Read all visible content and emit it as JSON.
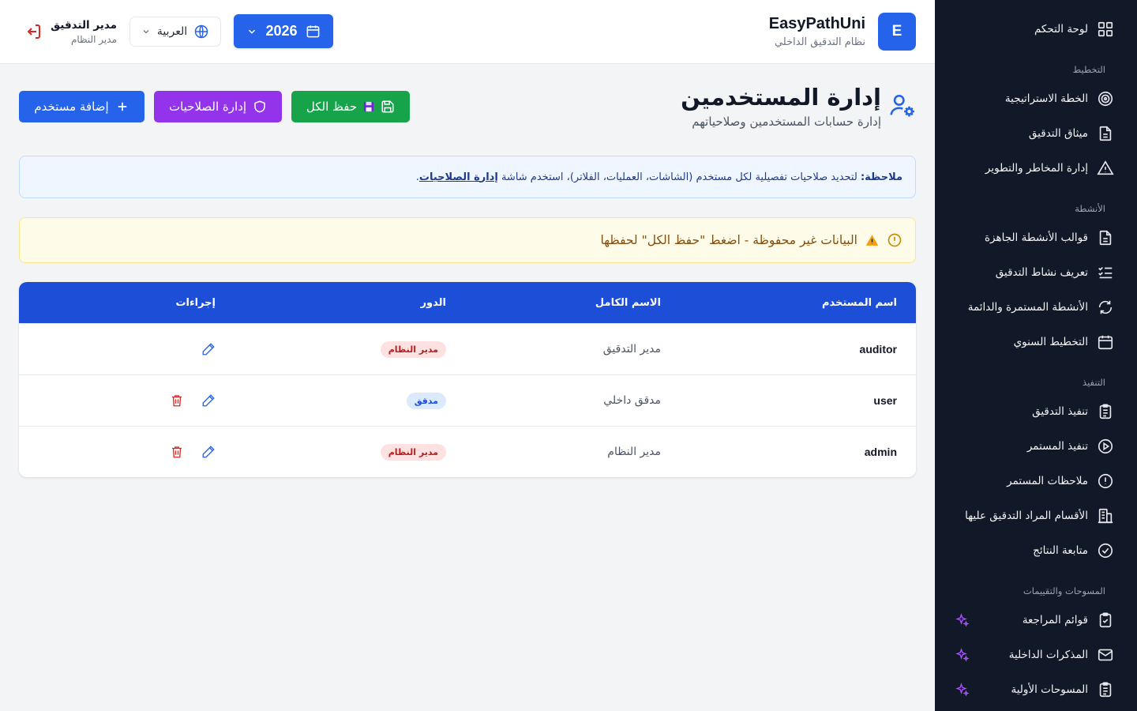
{
  "header": {
    "logo_letter": "E",
    "app_name": "EasyPathUni",
    "app_subtitle": "نظام التدقيق الداخلي",
    "year": "2026",
    "language": "العربية",
    "user_name": "مدير التدقيق",
    "user_role": "مدير النظام"
  },
  "sidebar": {
    "dashboard": "لوحة التحكم",
    "sections": {
      "planning": "التخطيط",
      "activities": "الأنشطة",
      "execution": "التنفيذ",
      "surveys": "المسوحات والتقييمات"
    },
    "items": {
      "strategic_plan": "الخطة الاستراتيجية",
      "audit_charter": "ميثاق التدقيق",
      "risk_management": "إدارة المخاطر والتطوير",
      "activity_templates": "قوالب الأنشطة الجاهزة",
      "activity_definition": "تعريف نشاط التدقيق",
      "continuous_activities": "الأنشطة المستمرة والدائمة",
      "annual_planning": "التخطيط السنوي",
      "audit_execution": "تنفيذ التدقيق",
      "continuous_execution": "تنفيذ المستمر",
      "continuous_notes": "ملاحظات المستمر",
      "audited_departments": "الأقسام المراد التدقيق عليها",
      "results_followup": "متابعة النتائج",
      "checklists": "قوائم المراجعة",
      "internal_memos": "المذكرات الداخلية",
      "initial_surveys": "المسوحات الأولية"
    }
  },
  "page": {
    "title": "إدارة المستخدمين",
    "subtitle": "إدارة حسابات المستخدمين وصلاحياتهم",
    "save_all": "حفظ الكل",
    "manage_permissions": "إدارة الصلاحيات",
    "add_user": "إضافة مستخدم",
    "note_label": "ملاحظة:",
    "note_text": "لتحديد صلاحيات تفصيلية لكل مستخدم (الشاشات، العمليات، الفلاتر)، استخدم شاشة",
    "note_link": "إدارة الصلاحيات",
    "note_end": ".",
    "warning": "البيانات غير محفوظة - اضغط \"حفظ الكل\" لحفظها"
  },
  "table": {
    "headers": {
      "username": "اسم المستخدم",
      "full_name": "الاسم الكامل",
      "role": "الدور",
      "actions": "إجراءات"
    },
    "rows": [
      {
        "username": "auditor",
        "full_name": "مدير التدقيق",
        "role": "مدير النظام",
        "role_color": "#b91c1c",
        "deletable": false
      },
      {
        "username": "user",
        "full_name": "مدقق داخلي",
        "role": "مدقق",
        "role_color": "#1d4ed8",
        "deletable": true
      },
      {
        "username": "admin",
        "full_name": "مدير النظام",
        "role": "مدير النظام",
        "role_color": "#b91c1c",
        "deletable": true
      }
    ]
  },
  "colors": {
    "primary": "#2563eb",
    "success": "#16a34a",
    "purple": "#9333ea",
    "sidebar_bg": "#111827",
    "danger": "#dc2626"
  }
}
